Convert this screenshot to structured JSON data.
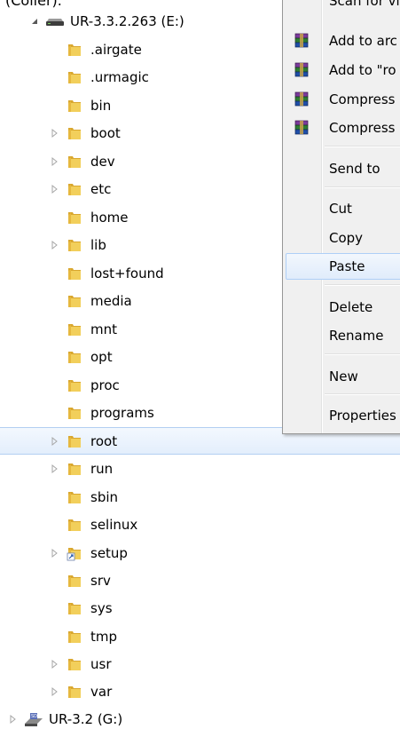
{
  "top_cut_text": "(Coller).",
  "tree": {
    "drive_e": {
      "label": "UR-3.3.2.263 (E:)",
      "icon": "drive-icon",
      "expanded": true
    },
    "folders": [
      {
        "label": ".airgate",
        "has_children": false,
        "icon": "folder-icon"
      },
      {
        "label": ".urmagic",
        "has_children": false,
        "icon": "folder-icon"
      },
      {
        "label": "bin",
        "has_children": false,
        "icon": "folder-icon"
      },
      {
        "label": "boot",
        "has_children": true,
        "icon": "folder-icon"
      },
      {
        "label": "dev",
        "has_children": true,
        "icon": "folder-icon"
      },
      {
        "label": "etc",
        "has_children": true,
        "icon": "folder-icon"
      },
      {
        "label": "home",
        "has_children": false,
        "icon": "folder-icon"
      },
      {
        "label": "lib",
        "has_children": true,
        "icon": "folder-icon"
      },
      {
        "label": "lost+found",
        "has_children": false,
        "icon": "folder-icon"
      },
      {
        "label": "media",
        "has_children": false,
        "icon": "folder-icon"
      },
      {
        "label": "mnt",
        "has_children": false,
        "icon": "folder-icon"
      },
      {
        "label": "opt",
        "has_children": false,
        "icon": "folder-icon"
      },
      {
        "label": "proc",
        "has_children": false,
        "icon": "folder-icon"
      },
      {
        "label": "programs",
        "has_children": false,
        "icon": "folder-icon"
      },
      {
        "label": "root",
        "has_children": true,
        "icon": "folder-icon",
        "selected": true
      },
      {
        "label": "run",
        "has_children": true,
        "icon": "folder-icon"
      },
      {
        "label": "sbin",
        "has_children": false,
        "icon": "folder-icon"
      },
      {
        "label": "selinux",
        "has_children": false,
        "icon": "folder-icon"
      },
      {
        "label": "setup",
        "has_children": true,
        "icon": "folder-shortcut-icon"
      },
      {
        "label": "srv",
        "has_children": false,
        "icon": "folder-icon"
      },
      {
        "label": "sys",
        "has_children": false,
        "icon": "folder-icon"
      },
      {
        "label": "tmp",
        "has_children": false,
        "icon": "folder-icon"
      },
      {
        "label": "usr",
        "has_children": true,
        "icon": "folder-icon"
      },
      {
        "label": "var",
        "has_children": true,
        "icon": "folder-icon"
      }
    ],
    "drive_g": {
      "label": "UR-3.2 (G:)",
      "icon": "sd-card-drive-icon",
      "expanded": false
    }
  },
  "context_menu": {
    "items": [
      {
        "label": "Scan for vi",
        "icon": ""
      },
      {
        "label": "Add to arc",
        "icon": "winrar-icon"
      },
      {
        "label": "Add to \"ro",
        "icon": "winrar-icon"
      },
      {
        "label": "Compress",
        "icon": "winrar-icon"
      },
      {
        "label": "Compress",
        "icon": "winrar-icon"
      },
      {
        "label": "Send to",
        "icon": ""
      },
      {
        "label": "Cut",
        "icon": ""
      },
      {
        "label": "Copy",
        "icon": ""
      },
      {
        "label": "Paste",
        "icon": "",
        "hovered": true
      },
      {
        "label": "Delete",
        "icon": ""
      },
      {
        "label": "Rename",
        "icon": ""
      },
      {
        "label": "New",
        "icon": ""
      },
      {
        "label": "Properties",
        "icon": ""
      }
    ]
  },
  "colors": {
    "folder_yellow": "#e8c24c",
    "selection_border": "#b3cff2",
    "menu_background": "#f0f0f0"
  }
}
